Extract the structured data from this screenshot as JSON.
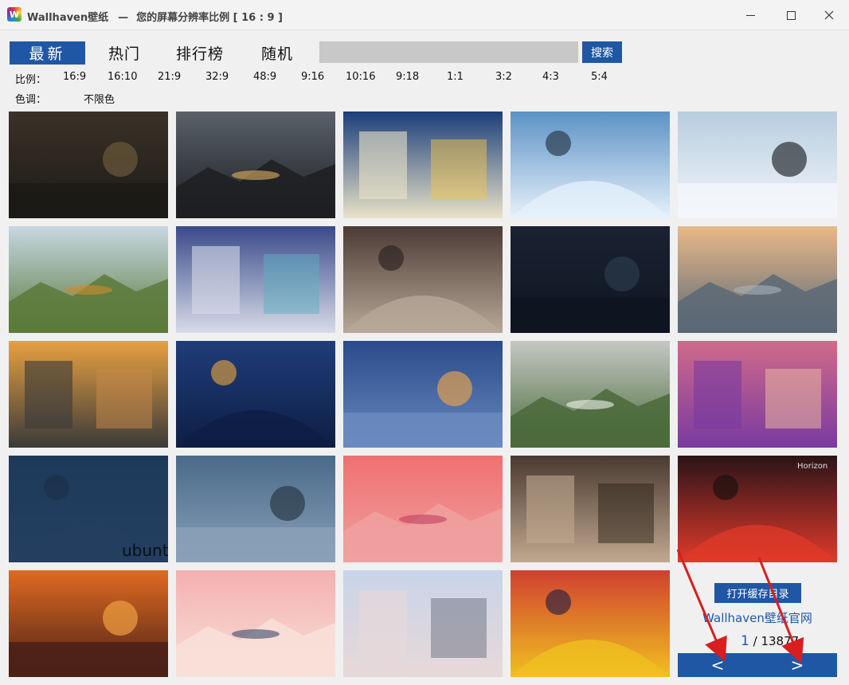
{
  "window": {
    "app_name": "Wallhaven壁纸",
    "separator": "—",
    "subtitle": "您的屏幕分辨率比例 [ 16 : 9 ]",
    "icon_letter": "W"
  },
  "tabs": [
    {
      "label": "最新",
      "active": true
    },
    {
      "label": "热门",
      "active": false
    },
    {
      "label": "排行榜",
      "active": false
    },
    {
      "label": "随机",
      "active": false
    }
  ],
  "search": {
    "value": "",
    "placeholder": "",
    "button_label": "搜索"
  },
  "filters": {
    "ratio_label": "比例：",
    "ratios": [
      "16:9",
      "16:10",
      "21:9",
      "32:9",
      "48:9",
      "9:16",
      "10:16",
      "9:18",
      "1:1",
      "3:2",
      "4:3",
      "5:4"
    ],
    "color_label": "色调：",
    "color_value": "不限色"
  },
  "thumbnails": [
    {
      "subject": "anime-characters-dark",
      "colors": [
        "#3a3228",
        "#1c1a16",
        "#6b5a3a"
      ]
    },
    {
      "subject": "sunset-clouds-forest",
      "colors": [
        "#59616a",
        "#1d1f22",
        "#e3b060"
      ]
    },
    {
      "subject": "great-wave-starry-night",
      "colors": [
        "#1c3e7a",
        "#e9e2c8",
        "#f0c34a"
      ]
    },
    {
      "subject": "car-snow-forest",
      "colors": [
        "#5b92c4",
        "#e6f1fb",
        "#233445"
      ]
    },
    {
      "subject": "car-snow-road",
      "colors": [
        "#b8cde0",
        "#f3f6fa",
        "#2a2d33"
      ]
    },
    {
      "subject": "car-autumn-road",
      "colors": [
        "#c7d7e3",
        "#5a7a3a",
        "#d08a2a"
      ]
    },
    {
      "subject": "anime-girls-collage",
      "colors": [
        "#3a4a8a",
        "#d7dbe8",
        "#5bb0c0"
      ]
    },
    {
      "subject": "movie-photo-collage",
      "colors": [
        "#4b3b35",
        "#b8a898",
        "#2a2220"
      ]
    },
    {
      "subject": "night-lake-mountains",
      "colors": [
        "#1a2233",
        "#0f1520",
        "#2b3a4a"
      ]
    },
    {
      "subject": "lake-boat-mountains",
      "colors": [
        "#e9b988",
        "#5a6876",
        "#a9b2bb"
      ]
    },
    {
      "subject": "sunset-lake-town",
      "colors": [
        "#e8a040",
        "#3a3a3a",
        "#c78a4a"
      ]
    },
    {
      "subject": "night-harbor-lights",
      "colors": [
        "#1f3d7a",
        "#0e1e44",
        "#e0a040"
      ]
    },
    {
      "subject": "dusk-lake-castle",
      "colors": [
        "#2a4a8a",
        "#6a8ac0",
        "#e0a050"
      ]
    },
    {
      "subject": "wind-turbines-field",
      "colors": [
        "#c4c8c4",
        "#4a6a3a",
        "#f4f4f0"
      ]
    },
    {
      "subject": "portrait-purple-hair",
      "colors": [
        "#d06a8a",
        "#7a3aa0",
        "#f0c0a0"
      ]
    },
    {
      "subject": "ubuntu-wallpaper",
      "colors": [
        "#1e3a5a",
        "#243f60",
        "#1a2f48"
      ],
      "text": "ubuntu"
    },
    {
      "subject": "sky-clouds-sea",
      "colors": [
        "#4a6a8a",
        "#8aa0b8",
        "#2a3a48"
      ]
    },
    {
      "subject": "comic-heroine-flying",
      "colors": [
        "#f07070",
        "#f0a0a0",
        "#c04060"
      ]
    },
    {
      "subject": "game-character-girl",
      "colors": [
        "#4a3a30",
        "#c0a890",
        "#2a2218"
      ]
    },
    {
      "subject": "horizon-game-night-fire",
      "colors": [
        "#2a1418",
        "#e03a2a",
        "#1a1010"
      ],
      "text": "Horizon"
    },
    {
      "subject": "warrior-flames",
      "colors": [
        "#e06a20",
        "#4a2018",
        "#f0a040"
      ]
    },
    {
      "subject": "anime-girl-pink-hair",
      "colors": [
        "#f4b0b0",
        "#f8e0d8",
        "#3a4a6a"
      ]
    },
    {
      "subject": "street-lamps-birds",
      "colors": [
        "#c8d4e8",
        "#e8d8d8",
        "#6a7080"
      ]
    },
    {
      "subject": "comic-characters-group",
      "colors": [
        "#d04030",
        "#f0c020",
        "#2a2040"
      ]
    }
  ],
  "side_panel": {
    "open_cache_label": "打开缓存目录",
    "official_site_label": "Wallhaven壁纸官网",
    "current_page": "1",
    "page_separator": "/",
    "total_pages": "13877",
    "prev_label": "<",
    "next_label": ">"
  },
  "accent_color": "#1f57a5",
  "annotation_color": "#d81e1e"
}
